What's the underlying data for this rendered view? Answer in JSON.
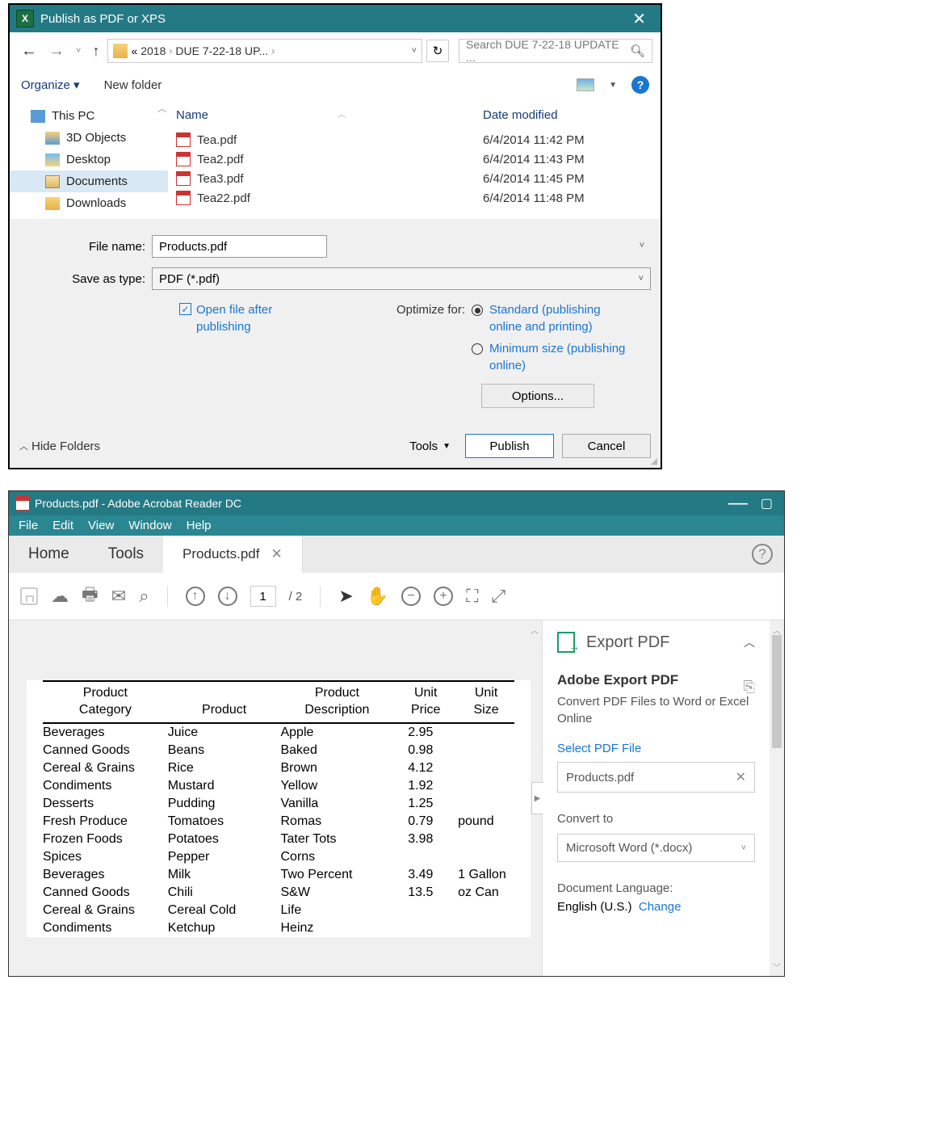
{
  "dialog": {
    "title": "Publish as PDF or XPS",
    "path": {
      "prefix": "«",
      "seg1": "2018",
      "seg2": "DUE 7-22-18 UP...",
      "suffix": ""
    },
    "search_placeholder": "Search DUE 7-22-18 UPDATE ...",
    "organize": "Organize",
    "newfolder": "New folder",
    "tree": {
      "thispc": "This PC",
      "3d": "3D Objects",
      "desktop": "Desktop",
      "documents": "Documents",
      "downloads": "Downloads"
    },
    "cols": {
      "name": "Name",
      "date": "Date modified"
    },
    "files": [
      {
        "name": "Tea.pdf",
        "date": "6/4/2014 11:42 PM"
      },
      {
        "name": "Tea2.pdf",
        "date": "6/4/2014 11:43 PM"
      },
      {
        "name": "Tea3.pdf",
        "date": "6/4/2014 11:45 PM"
      },
      {
        "name": "Tea22.pdf",
        "date": "6/4/2014 11:48 PM"
      }
    ],
    "filename_label": "File name:",
    "filename_value": "Products.pdf",
    "saveas_label": "Save as type:",
    "saveas_value": "PDF (*.pdf)",
    "open_after": "Open file after publishing",
    "optimize_label": "Optimize for:",
    "opt_standard": "Standard (publishing online and printing)",
    "opt_min": "Minimum size (publishing online)",
    "options_btn": "Options...",
    "hide_folders": "Hide Folders",
    "tools": "Tools",
    "publish": "Publish",
    "cancel": "Cancel"
  },
  "acrobat": {
    "title": "Products.pdf - Adobe Acrobat Reader DC",
    "menu": [
      "File",
      "Edit",
      "View",
      "Window",
      "Help"
    ],
    "tabs": {
      "home": "Home",
      "tools": "Tools",
      "doc": "Products.pdf"
    },
    "page_current": "1",
    "page_total": "/ 2",
    "table": {
      "headers": {
        "cat": "Product Category",
        "prod": "Product",
        "desc": "Product Description",
        "price": "Unit Price",
        "size": "Unit Size"
      },
      "rows": [
        {
          "cat": "Beverages",
          "prod": "Juice",
          "desc": "Apple",
          "price": "2.95",
          "size": ""
        },
        {
          "cat": "Canned Goods",
          "prod": "Beans",
          "desc": "Baked",
          "price": "0.98",
          "size": ""
        },
        {
          "cat": "Cereal & Grains",
          "prod": "Rice",
          "desc": "Brown",
          "price": "4.12",
          "size": ""
        },
        {
          "cat": "Condiments",
          "prod": "Mustard",
          "desc": "Yellow",
          "price": "1.92",
          "size": ""
        },
        {
          "cat": "Desserts",
          "prod": "Pudding",
          "desc": "Vanilla",
          "price": "1.25",
          "size": ""
        },
        {
          "cat": "Fresh Produce",
          "prod": "Tomatoes",
          "desc": "Romas",
          "price": "0.79",
          "size": "pound"
        },
        {
          "cat": "Frozen Foods",
          "prod": "Potatoes",
          "desc": "Tater Tots",
          "price": "3.98",
          "size": ""
        },
        {
          "cat": "Spices",
          "prod": "Pepper",
          "desc": "Corns",
          "price": "",
          "size": ""
        },
        {
          "cat": "Beverages",
          "prod": "Milk",
          "desc": "Two Percent",
          "price": "3.49",
          "size": "1 Gallon"
        },
        {
          "cat": "Canned Goods",
          "prod": "Chili",
          "desc": "S&W",
          "price": "13.5",
          "size": "oz Can"
        },
        {
          "cat": "Cereal & Grains",
          "prod": "Cereal Cold",
          "desc": "Life",
          "price": "",
          "size": ""
        },
        {
          "cat": "Condiments",
          "prod": "Ketchup",
          "desc": "Heinz",
          "price": "",
          "size": ""
        }
      ]
    },
    "rhs": {
      "title": "Export PDF",
      "h4": "Adobe Export PDF",
      "sub": "Convert PDF Files to Word or Excel Online",
      "select": "Select PDF File",
      "file": "Products.pdf",
      "convert": "Convert to",
      "target": "Microsoft Word (*.docx)",
      "lang_label": "Document Language:",
      "lang_val": "English (U.S.)",
      "change": "Change"
    }
  }
}
